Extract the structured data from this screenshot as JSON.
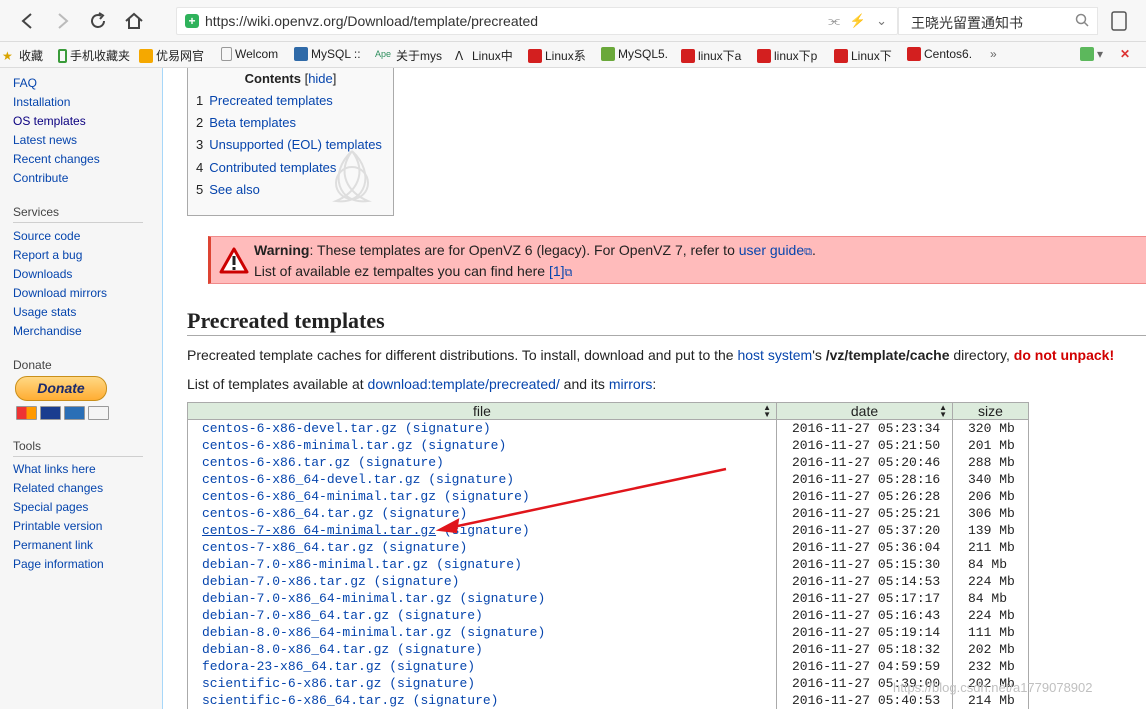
{
  "browser": {
    "url": "https://wiki.openvz.org/Download/template/precreated",
    "search_text": "王晓光留置通知书"
  },
  "bookmarks": [
    {
      "label": "收藏",
      "color": "#d9a400"
    },
    {
      "label": "手机收藏夹",
      "color": "#3a9b3a"
    },
    {
      "label": "优易网官",
      "color": "#f5a800"
    },
    {
      "label": "Welcom",
      "color": "#ffffff"
    },
    {
      "label": "MySQL ::",
      "color": "#2f6aa8"
    },
    {
      "label": "关于mys",
      "color": "#ffffff"
    },
    {
      "label": "Linux中",
      "color": "#ffffff"
    },
    {
      "label": "Linux系",
      "color": "#d31f1f"
    },
    {
      "label": "MySQL5.",
      "color": "#6aa83a"
    },
    {
      "label": "linux下a",
      "color": "#d31f1f"
    },
    {
      "label": "linux下p",
      "color": "#d31f1f"
    },
    {
      "label": "Linux下",
      "color": "#d31f1f"
    },
    {
      "label": "Centos6.",
      "color": "#d31f1f"
    }
  ],
  "sidebar": {
    "nav": [
      "FAQ",
      "Installation",
      "OS templates",
      "Latest news",
      "Recent changes",
      "Contribute"
    ],
    "services_title": "Services",
    "services": [
      "Source code",
      "Report a bug",
      "Downloads",
      "Download mirrors",
      "Usage stats",
      "Merchandise"
    ],
    "donate_title": "Donate",
    "donate_label": "Donate",
    "tools_title": "Tools",
    "tools": [
      "What links here",
      "Related changes",
      "Special pages",
      "Printable version",
      "Permanent link",
      "Page information"
    ]
  },
  "toc": {
    "title": "Contents",
    "hide": "hide",
    "items": [
      {
        "num": "1",
        "label": "Precreated templates"
      },
      {
        "num": "2",
        "label": "Beta templates"
      },
      {
        "num": "3",
        "label": "Unsupported (EOL) templates"
      },
      {
        "num": "4",
        "label": "Contributed templates"
      },
      {
        "num": "5",
        "label": "See also"
      }
    ]
  },
  "warning": {
    "label": "Warning",
    "text1": ": These templates are for OpenVZ 6 (legacy). For OpenVZ 7, refer to ",
    "link1": "user guide",
    "text1_end": ".",
    "text2": "List of available ez tempaltes you can find here ",
    "link2": "[1]"
  },
  "section": {
    "heading": "Precreated templates",
    "p1_a": "Precreated template caches for different distributions. To install, download and put to the ",
    "p1_link": "host system",
    "p1_b": "'s ",
    "p1_path": "/vz/template/cache",
    "p1_c": " directory, ",
    "p1_warn": "do not unpack!",
    "p2_a": "List of templates available at ",
    "p2_link1": "download:template/precreated/",
    "p2_b": " and its ",
    "p2_link2": "mirrors",
    "p2_c": ":"
  },
  "table": {
    "headers": [
      "file",
      "date",
      "size"
    ],
    "signature_label": "(signature)",
    "rows": [
      {
        "file": "centos-6-x86-devel.tar.gz",
        "date": "2016-11-27 05:23:34",
        "size": "320 Mb"
      },
      {
        "file": "centos-6-x86-minimal.tar.gz",
        "date": "2016-11-27 05:21:50",
        "size": "201 Mb"
      },
      {
        "file": "centos-6-x86.tar.gz",
        "date": "2016-11-27 05:20:46",
        "size": "288 Mb"
      },
      {
        "file": "centos-6-x86_64-devel.tar.gz",
        "date": "2016-11-27 05:28:16",
        "size": "340 Mb"
      },
      {
        "file": "centos-6-x86_64-minimal.tar.gz",
        "date": "2016-11-27 05:26:28",
        "size": "206 Mb"
      },
      {
        "file": "centos-6-x86_64.tar.gz",
        "date": "2016-11-27 05:25:21",
        "size": "306 Mb"
      },
      {
        "file": "centos-7-x86_64-minimal.tar.gz",
        "date": "2016-11-27 05:37:20",
        "size": "139 Mb",
        "highlight": true
      },
      {
        "file": "centos-7-x86_64.tar.gz",
        "date": "2016-11-27 05:36:04",
        "size": "211 Mb"
      },
      {
        "file": "debian-7.0-x86-minimal.tar.gz",
        "date": "2016-11-27 05:15:30",
        "size": "84 Mb"
      },
      {
        "file": "debian-7.0-x86.tar.gz",
        "date": "2016-11-27 05:14:53",
        "size": "224 Mb"
      },
      {
        "file": "debian-7.0-x86_64-minimal.tar.gz",
        "date": "2016-11-27 05:17:17",
        "size": "84 Mb"
      },
      {
        "file": "debian-7.0-x86_64.tar.gz",
        "date": "2016-11-27 05:16:43",
        "size": "224 Mb"
      },
      {
        "file": "debian-8.0-x86_64-minimal.tar.gz",
        "date": "2016-11-27 05:19:14",
        "size": "111 Mb"
      },
      {
        "file": "debian-8.0-x86_64.tar.gz",
        "date": "2016-11-27 05:18:32",
        "size": "202 Mb"
      },
      {
        "file": "fedora-23-x86_64.tar.gz",
        "date": "2016-11-27 04:59:59",
        "size": "232 Mb"
      },
      {
        "file": "scientific-6-x86.tar.gz",
        "date": "2016-11-27 05:39:00",
        "size": "202 Mb"
      },
      {
        "file": "scientific-6-x86_64.tar.gz",
        "date": "2016-11-27 05:40:53",
        "size": "214 Mb"
      }
    ]
  },
  "watermark": "https://blog.csdn.net/a1779078902",
  "colors": {
    "link": "#0645ad",
    "warning_bg": "#ffbbbb",
    "table_header": "#dcebdc",
    "annotation_arrow": "#e0151b"
  }
}
